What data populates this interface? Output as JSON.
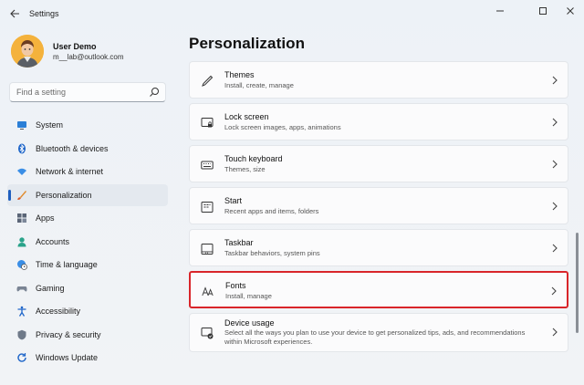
{
  "window": {
    "title": "Settings",
    "controls": {
      "minimize": "—",
      "maximize": "□",
      "close": "✕"
    }
  },
  "profile": {
    "name": "User Demo",
    "email": "m__lab@outlook.com"
  },
  "search": {
    "placeholder": "Find a setting"
  },
  "sidebar": {
    "items": [
      {
        "label": "System",
        "icon": "monitor-icon",
        "active": false
      },
      {
        "label": "Bluetooth & devices",
        "icon": "bluetooth-icon",
        "active": false
      },
      {
        "label": "Network & internet",
        "icon": "wifi-icon",
        "active": false
      },
      {
        "label": "Personalization",
        "icon": "brush-icon",
        "active": true
      },
      {
        "label": "Apps",
        "icon": "apps-icon",
        "active": false
      },
      {
        "label": "Accounts",
        "icon": "person-icon",
        "active": false
      },
      {
        "label": "Time & language",
        "icon": "globe-clock-icon",
        "active": false
      },
      {
        "label": "Gaming",
        "icon": "gamepad-icon",
        "active": false
      },
      {
        "label": "Accessibility",
        "icon": "accessibility-icon",
        "active": false
      },
      {
        "label": "Privacy & security",
        "icon": "shield-icon",
        "active": false
      },
      {
        "label": "Windows Update",
        "icon": "update-icon",
        "active": false
      }
    ]
  },
  "main": {
    "title": "Personalization",
    "cards": [
      {
        "title": "Themes",
        "subtitle": "Install, create, manage",
        "icon": "pen-icon"
      },
      {
        "title": "Lock screen",
        "subtitle": "Lock screen images, apps, animations",
        "icon": "lock-screen-icon"
      },
      {
        "title": "Touch keyboard",
        "subtitle": "Themes, size",
        "icon": "keyboard-icon"
      },
      {
        "title": "Start",
        "subtitle": "Recent apps and items, folders",
        "icon": "start-icon"
      },
      {
        "title": "Taskbar",
        "subtitle": "Taskbar behaviors, system pins",
        "icon": "taskbar-icon"
      },
      {
        "title": "Fonts",
        "subtitle": "Install, manage",
        "icon": "fonts-icon",
        "highlighted": true
      },
      {
        "title": "Device usage",
        "subtitle": "Select all the ways you plan to use your device to get personalized tips, ads, and recommendations within Microsoft experiences.",
        "icon": "device-usage-icon"
      }
    ]
  },
  "colors": {
    "accent": "#1f5fbf",
    "highlight": "#d9252a"
  }
}
